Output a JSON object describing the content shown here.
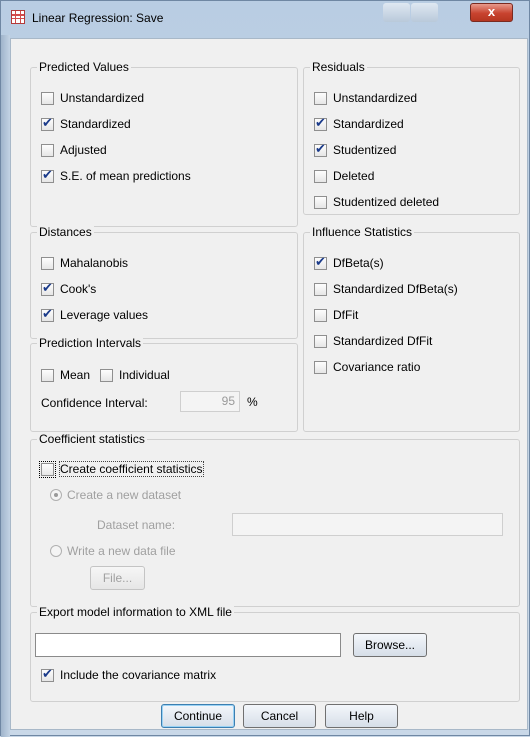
{
  "window": {
    "title": "Linear Regression: Save",
    "close_glyph": "x",
    "accent": "#c8432f"
  },
  "predicted": {
    "title": "Predicted Values",
    "items": [
      {
        "label": "Unstandardized",
        "checked": false
      },
      {
        "label": "Standardized",
        "checked": true
      },
      {
        "label": "Adjusted",
        "checked": false
      },
      {
        "label": "S.E. of mean predictions",
        "checked": true
      }
    ]
  },
  "residuals": {
    "title": "Residuals",
    "items": [
      {
        "label": "Unstandardized",
        "checked": false
      },
      {
        "label": "Standardized",
        "checked": true
      },
      {
        "label": "Studentized",
        "checked": true
      },
      {
        "label": "Deleted",
        "checked": false
      },
      {
        "label": "Studentized deleted",
        "checked": false
      }
    ]
  },
  "distances": {
    "title": "Distances",
    "items": [
      {
        "label": "Mahalanobis",
        "checked": false
      },
      {
        "label": "Cook's",
        "checked": true
      },
      {
        "label": "Leverage values",
        "checked": true
      }
    ]
  },
  "influence": {
    "title": "Influence Statistics",
    "items": [
      {
        "label": "DfBeta(s)",
        "checked": true
      },
      {
        "label": "Standardized DfBeta(s)",
        "checked": false
      },
      {
        "label": "DfFit",
        "checked": false
      },
      {
        "label": "Standardized DfFit",
        "checked": false
      },
      {
        "label": "Covariance ratio",
        "checked": false
      }
    ]
  },
  "prediction_intervals": {
    "title": "Prediction Intervals",
    "mean_label": "Mean",
    "mean_checked": false,
    "individual_label": "Individual",
    "individual_checked": false,
    "ci_label": "Confidence Interval:",
    "ci_value": "95",
    "ci_unit": "%"
  },
  "coefficient": {
    "title": "Coefficient statistics",
    "create_label": "Create coefficient statistics",
    "create_checked": false,
    "new_dataset_label": "Create a new dataset",
    "dataset_name_label": "Dataset name:",
    "dataset_name_value": "",
    "write_file_label": "Write a new data file",
    "file_button": "File..."
  },
  "export": {
    "title": "Export model information to XML file",
    "path_value": "",
    "browse_button": "Browse...",
    "include_label": "Include the covariance matrix",
    "include_checked": true
  },
  "buttons": {
    "continue": "Continue",
    "cancel": "Cancel",
    "help": "Help"
  }
}
